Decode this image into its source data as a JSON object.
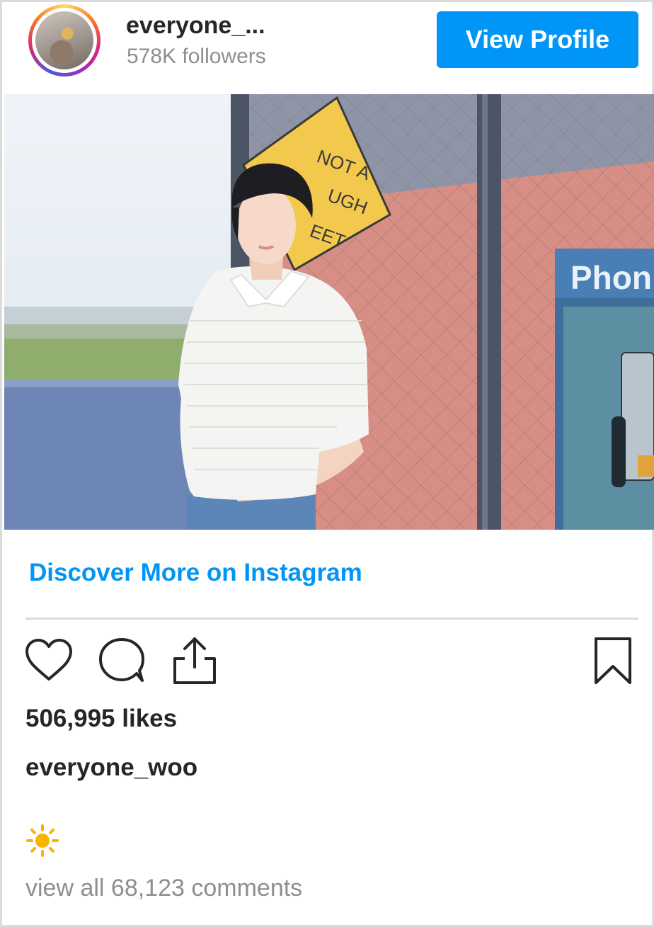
{
  "profile": {
    "username_short": "everyone_...",
    "followers": "578K followers",
    "view_profile_label": "View Profile"
  },
  "photo": {
    "sign_text_lines": [
      "NOT A",
      "UGH",
      "EET"
    ],
    "booth_label": "Phon"
  },
  "discover_label": "Discover More on Instagram",
  "actions": {
    "like_icon": "heart-icon",
    "comment_icon": "comment-icon",
    "share_icon": "share-icon",
    "save_icon": "bookmark-icon"
  },
  "likes": "506,995 likes",
  "caption": {
    "username": "everyone_woo",
    "emoji": "☀"
  },
  "comments_link": "view all 68,123 comments",
  "colors": {
    "accent": "#0095f6",
    "text": "#262626",
    "muted": "#8e8e8e",
    "divider": "#dbdbdb"
  }
}
